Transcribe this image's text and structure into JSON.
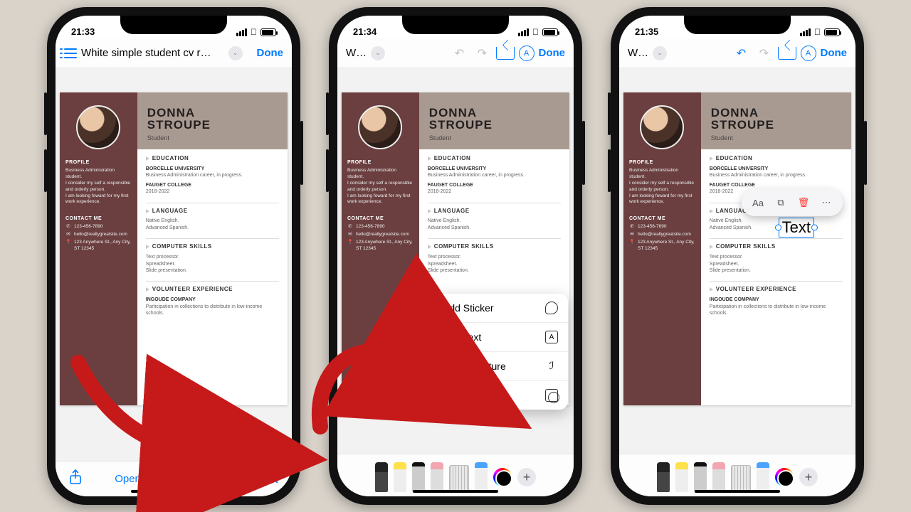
{
  "phones": [
    {
      "time": "21:33",
      "title": "White simple student cv r…",
      "done": "Done",
      "footer": {
        "open": "Open in Books"
      }
    },
    {
      "time": "21:34",
      "title": "W…",
      "done": "Done"
    },
    {
      "time": "21:35",
      "title": "W…",
      "done": "Done",
      "text_obj": "Text"
    }
  ],
  "menu": {
    "sticker": "Add Sticker",
    "text": "Add Text",
    "signature": "Add Signature",
    "shape": "Add Shape"
  },
  "cv": {
    "name1": "DONNA",
    "name2": "STROUPE",
    "role": "Student",
    "profile_h": "PROFILE",
    "profile": "Business Administration student.\nI consider my self a responsible and orderly person.\nI am looking foward for my first work experience.",
    "contact_h": "CONTACT ME",
    "phone": "123-456-7890",
    "email": "hello@reallygreatsite.com",
    "addr": "123 Anywhere St., Any City, ST 12345",
    "edu_h": "EDUCATION",
    "edu1_t": "BORCELLE UNIVERSITY",
    "edu1_b": "Business Administration career, in progress.",
    "edu2_t": "FAUGET COLLEGE",
    "edu2_b": "2018-2022",
    "lang_h": "LANGUAGE",
    "lang": "Native English.\nAdvanced Spanish.",
    "cs_h": "COMPUTER SKILLS",
    "cs": "Text processor.\nSpreadsheet.\nSlide presentation.",
    "vol_h": "VOLUNTEER EXPERIENCE",
    "vol_t": "INGOUDE COMPANY",
    "vol_b": "Participation in collections to distribute in low-income schools."
  }
}
